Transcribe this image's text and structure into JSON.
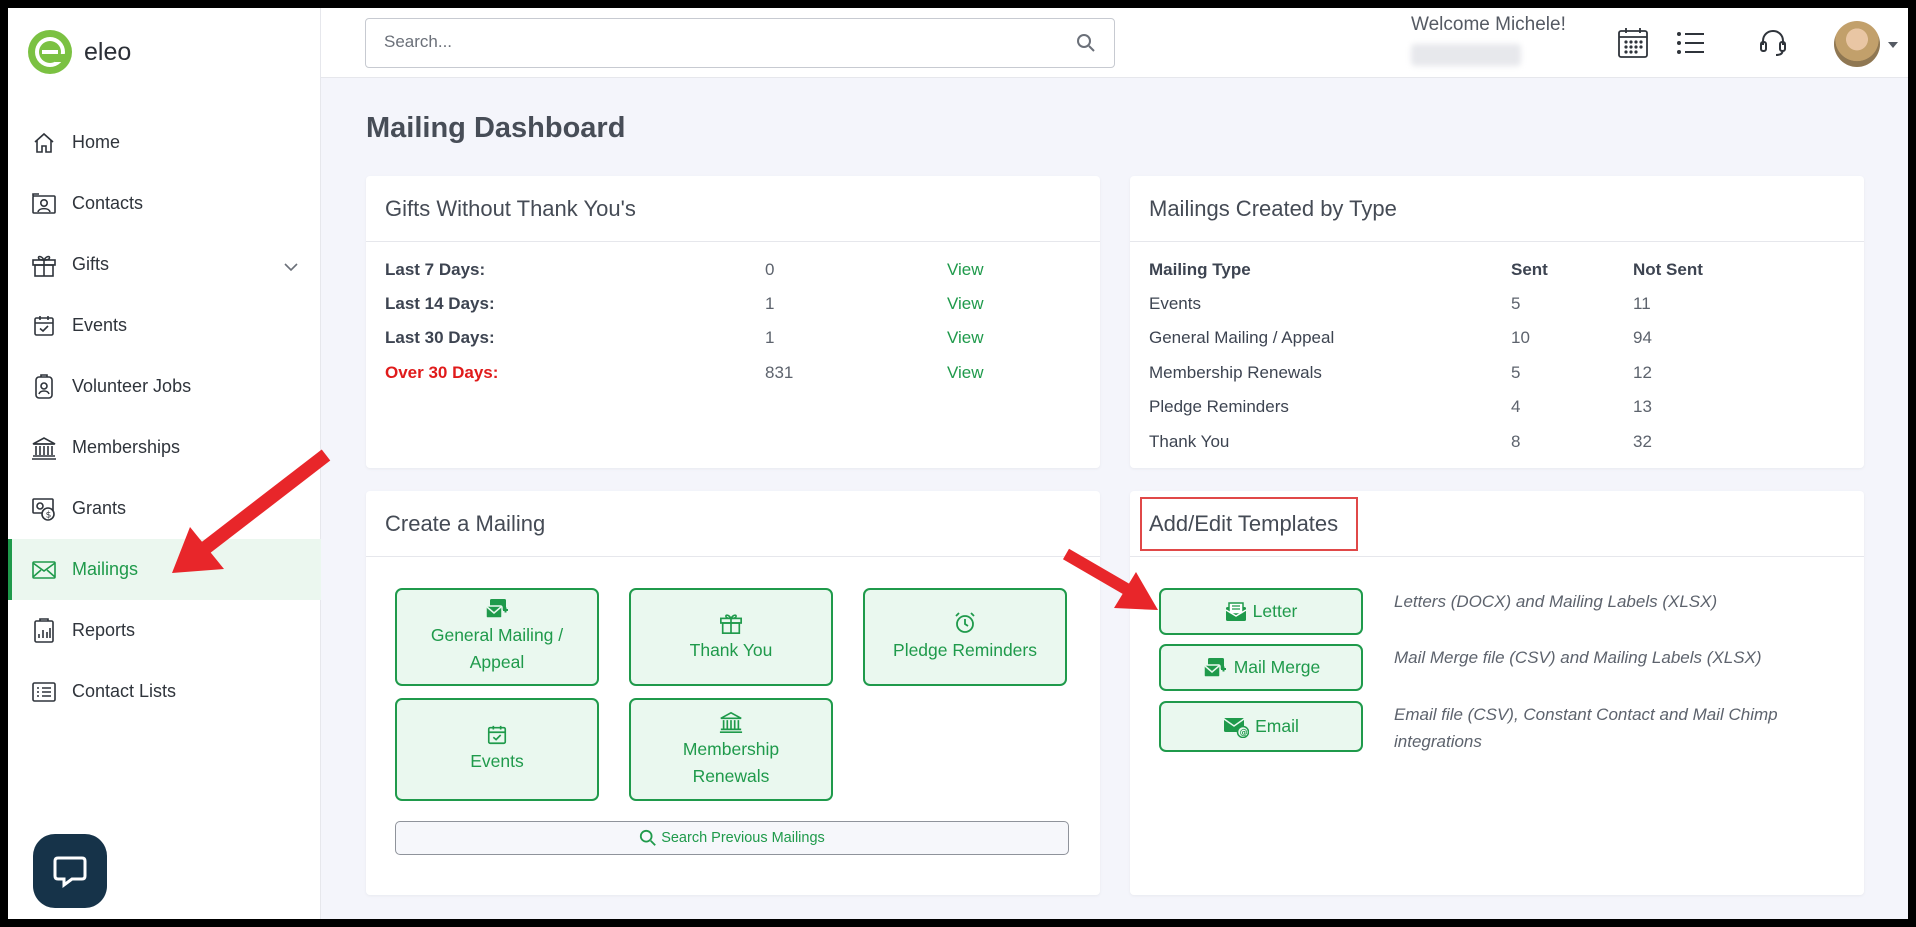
{
  "app": {
    "logo_text": "eleo"
  },
  "sidebar": {
    "items": [
      {
        "label": "Home",
        "icon": "home-icon"
      },
      {
        "label": "Contacts",
        "icon": "contact-card-icon"
      },
      {
        "label": "Gifts",
        "icon": "gift-icon",
        "has_submenu": true
      },
      {
        "label": "Events",
        "icon": "calendar-check-icon"
      },
      {
        "label": "Volunteer Jobs",
        "icon": "badge-icon"
      },
      {
        "label": "Memberships",
        "icon": "bank-icon"
      },
      {
        "label": "Grants",
        "icon": "grant-icon"
      },
      {
        "label": "Mailings",
        "icon": "envelope-icon",
        "active": true
      },
      {
        "label": "Reports",
        "icon": "report-icon"
      },
      {
        "label": "Contact Lists",
        "icon": "list-icon"
      }
    ]
  },
  "header": {
    "search_placeholder": "Search...",
    "welcome": "Welcome Michele!"
  },
  "page": {
    "title": "Mailing Dashboard"
  },
  "gifts_card": {
    "title": "Gifts Without Thank You's",
    "rows": [
      {
        "label": "Last 7 Days:",
        "count": "0",
        "action": "View"
      },
      {
        "label": "Last 14 Days:",
        "count": "1",
        "action": "View"
      },
      {
        "label": "Last 30 Days:",
        "count": "1",
        "action": "View"
      },
      {
        "label": "Over 30 Days:",
        "count": "831",
        "action": "View",
        "alert": true
      }
    ]
  },
  "mailings_card": {
    "title": "Mailings Created by Type",
    "columns": [
      "Mailing Type",
      "Sent",
      "Not Sent"
    ],
    "rows": [
      [
        "Events",
        "5",
        "11"
      ],
      [
        "General Mailing / Appeal",
        "10",
        "94"
      ],
      [
        "Membership Renewals",
        "5",
        "12"
      ],
      [
        "Pledge Reminders",
        "4",
        "13"
      ],
      [
        "Thank You",
        "8",
        "32"
      ]
    ]
  },
  "create_card": {
    "title": "Create a Mailing",
    "buttons": [
      {
        "label": "General Mailing / Appeal",
        "icon": "mail-stack-icon"
      },
      {
        "label": "Thank You",
        "icon": "gift-icon"
      },
      {
        "label": "Pledge Reminders",
        "icon": "alarm-clock-icon"
      },
      {
        "label": "Events",
        "icon": "calendar-check-icon"
      },
      {
        "label": "Membership Renewals",
        "icon": "bank-icon"
      }
    ],
    "search_previous": "Search Previous Mailings"
  },
  "templates_card": {
    "title": "Add/Edit Templates",
    "items": [
      {
        "label": "Letter",
        "icon": "letter-icon",
        "description": "Letters (DOCX) and Mailing Labels (XLSX)"
      },
      {
        "label": "Mail Merge",
        "icon": "mail-merge-icon",
        "description": "Mail Merge file (CSV) and Mailing Labels (XLSX)"
      },
      {
        "label": "Email",
        "icon": "email-at-icon",
        "description": "Email file (CSV), Constant Contact and Mail Chimp integrations"
      }
    ]
  },
  "colors": {
    "accent": "#1f9a4b",
    "alert": "#e01b1b",
    "annotation": "#e8262a",
    "chat": "#163349"
  }
}
